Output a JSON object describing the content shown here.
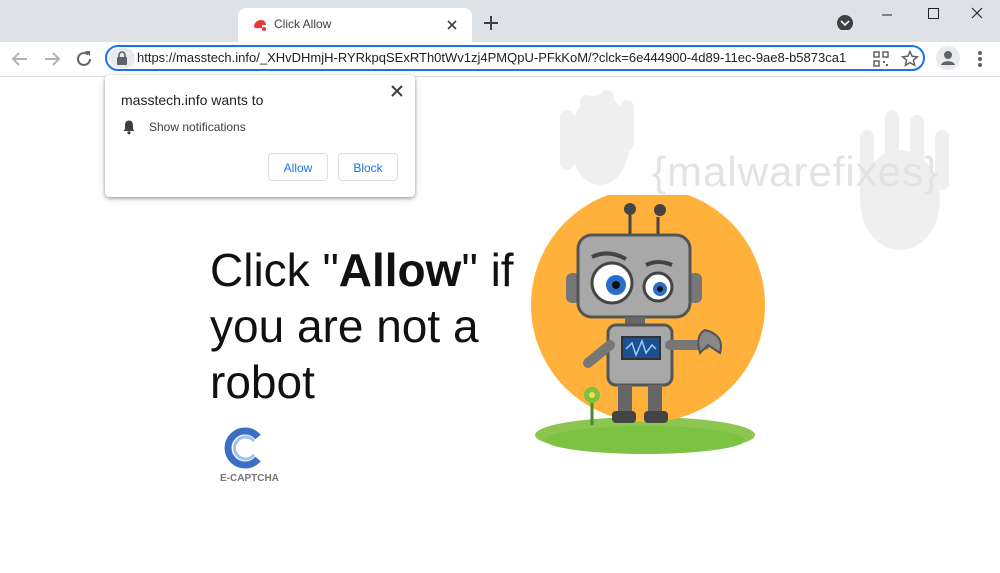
{
  "browser": {
    "tab_title": "Click Allow",
    "url": "https://masstech.info/_XHvDHmjH-RYRkpqSExRTh0tWv1zj4PMQpU-PFkKoM/?clck=6e444900-4d89-11ec-9ae8-b5873ca1"
  },
  "popup": {
    "title": "masstech.info wants to",
    "permission": "Show notifications",
    "allow_label": "Allow",
    "block_label": "Block"
  },
  "page": {
    "headline_pre": "Click \"",
    "headline_bold": "Allow",
    "headline_post": "\" if you are not a robot",
    "watermark": "{malwarefixes}",
    "captcha_label": "E-CAPTCHA"
  },
  "colors": {
    "accent": "#1a73e8",
    "robot_circle": "#ffb13b",
    "grass": "#7cc243"
  }
}
